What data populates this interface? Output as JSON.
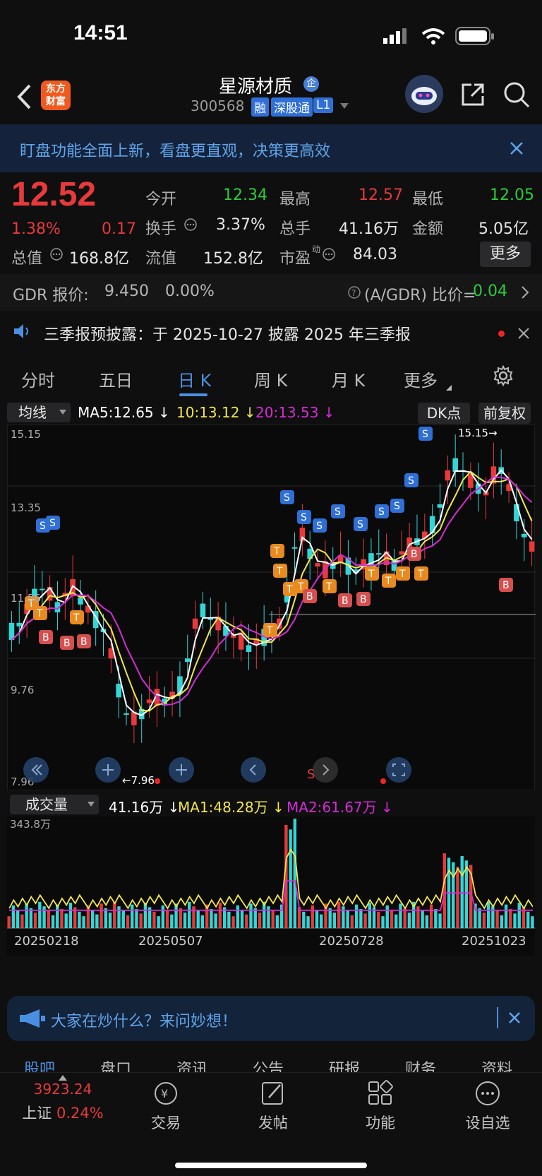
{
  "status": {
    "time": "14:51"
  },
  "header": {
    "logo_text_1": "东方",
    "logo_text_2": "财富",
    "stock_name": "星源材质",
    "badge": "企",
    "code": "300568",
    "tags": [
      "融",
      "深股通",
      "L1"
    ]
  },
  "banner": {
    "text": "盯盘功能全面上新，看盘更直观，决策更高效"
  },
  "quote": {
    "price": "12.52",
    "pct": "1.38%",
    "change": "0.17",
    "open_label": "今开",
    "open": "12.34",
    "high_label": "最高",
    "high": "12.57",
    "low_label": "最低",
    "low": "12.05",
    "turnover_label": "换手",
    "turnover": "3.37%",
    "volume_label": "总手",
    "volume": "41.16万",
    "amount_label": "金额",
    "amount": "5.05亿",
    "mcap_label": "总值",
    "mcap": "168.8亿",
    "float_label": "流值",
    "float": "152.8亿",
    "pe_label": "市盈",
    "pe_sup": "动",
    "pe": "84.03",
    "more": "更多"
  },
  "gdr": {
    "label": "GDR 报价:",
    "price": "9.450",
    "pct": "0.00%",
    "ratio_label": "(A/GDR) 比价=",
    "ratio": "0.04"
  },
  "notice": {
    "text": "三季报预披露：于 2025-10-27 披露 2025 年三季报"
  },
  "tabs": [
    "分时",
    "五日",
    "日 K",
    "周 K",
    "月 K",
    "更多"
  ],
  "active_tab": 2,
  "ma_row": {
    "select": "均线",
    "ma5": "MA5:12.65",
    "ma10": "10:13.12",
    "ma20": "20:13.53",
    "dk": "DK点",
    "adjust": "前复权"
  },
  "chart": {
    "y_labels": [
      "15.15",
      "13.35",
      "11.56",
      "9.76",
      "7.96"
    ],
    "max_label": "15.15",
    "min_label": "7.96",
    "s_marker": "S"
  },
  "vol_row": {
    "select": "成交量",
    "vol": "41.16万",
    "ma1": "MA1:48.28万",
    "ma2": "MA2:61.67万"
  },
  "vol_chart": {
    "max_label": "343.8万",
    "dates": [
      "20250218",
      "20250507",
      "20250728",
      "20251023"
    ]
  },
  "ask": {
    "text": "大家在炒什么？来问妙想！"
  },
  "subtabs": [
    "股吧",
    "盘口",
    "资讯",
    "公告",
    "研报",
    "财务",
    "资料"
  ],
  "bottom": {
    "index_value": "3923.24",
    "index_name": "上证",
    "index_pct": "0.24%",
    "items": [
      "交易",
      "发帖",
      "功能",
      "设自选"
    ]
  },
  "colors": {
    "up": "#e83a3a",
    "down": "#33d6d6",
    "ma5": "#ffffff",
    "ma10": "#f2e64b",
    "ma20": "#d62ad6",
    "accent": "#4a90e2"
  }
}
